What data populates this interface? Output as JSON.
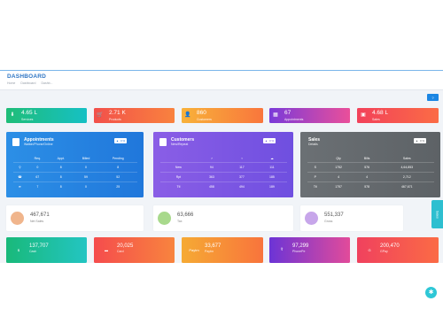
{
  "header": {
    "title": "DASHBOARD",
    "breadcrumb": [
      "Home",
      "Dashboard",
      "Dashb..."
    ],
    "help_label": "?"
  },
  "stats": [
    {
      "value": "4.65 L",
      "label": "Services",
      "icon": "download-icon",
      "gradient": [
        "#1fbd78",
        "#16c0c4"
      ]
    },
    {
      "value": "2.71 K",
      "label": "Products",
      "icon": "cart-icon",
      "gradient": [
        "#f2504b",
        "#f9823e"
      ]
    },
    {
      "value": "860",
      "label": "Customers",
      "icon": "user-icon",
      "gradient": [
        "#f8b23a",
        "#f9763c"
      ]
    },
    {
      "value": "67",
      "label": "Appointments",
      "icon": "calendar-icon",
      "gradient": [
        "#7a3ad9",
        "#ea4f9a"
      ]
    },
    {
      "value": "4.68 L",
      "label": "Sales",
      "icon": "wallet-icon",
      "gradient": [
        "#f2415a",
        "#fb6c45"
      ]
    }
  ],
  "appointments": {
    "title": "Appointments",
    "subtitle": "Walkin/Phone/Online",
    "badge": "0 %",
    "columns": [
      "Req.",
      "Appt.",
      "Billed",
      "Pending"
    ],
    "rows": [
      {
        "icon": "walkin-icon",
        "cells": [
          "0",
          "8",
          "0",
          "8"
        ]
      },
      {
        "icon": "phone-icon",
        "cells": [
          "67",
          "8",
          "59",
          "52"
        ]
      },
      {
        "icon": "wifi-icon",
        "cells": [
          "7",
          "8",
          "0",
          "25"
        ]
      }
    ]
  },
  "customers": {
    "title": "Customers",
    "subtitle": "New/Repeat",
    "badge": "0 %",
    "columns": [
      "",
      "♂",
      "♀",
      "☁"
    ],
    "rows": [
      {
        "icon": "",
        "cells": [
          "New",
          "94",
          "117",
          "111"
        ]
      },
      {
        "icon": "",
        "cells": [
          "Rpt",
          "363",
          "377",
          "185"
        ]
      },
      {
        "icon": "",
        "cells": [
          "Ttl",
          "458",
          "494",
          "189"
        ]
      }
    ]
  },
  "sales": {
    "title": "Sales",
    "subtitle": "Details",
    "badge": "0 %",
    "columns": [
      "",
      "Qty",
      "Bills",
      "Sales"
    ],
    "rows": [
      {
        "icon": "",
        "cells": [
          "S",
          "1752",
          "576",
          "4,64,853"
        ]
      },
      {
        "icon": "",
        "cells": [
          "P",
          "4",
          "4",
          "2,712"
        ]
      },
      {
        "icon": "",
        "cells": [
          "Ttl",
          "1757",
          "578",
          "467,671"
        ]
      }
    ]
  },
  "kpis": [
    {
      "value": "467,671",
      "label": "Net Sales",
      "icon": "wallet-icon",
      "color": "#f0b58c"
    },
    {
      "value": "63,666",
      "label": "Tax",
      "icon": "tax-icon",
      "color": "#a8d98c"
    },
    {
      "value": "551,337",
      "label": "Gross",
      "icon": "coins-icon",
      "color": "#c7a6ea"
    }
  ],
  "payments": [
    {
      "value": "137,707",
      "label": "Cash",
      "logo": "$",
      "gradient": [
        "#19b97a",
        "#23c5c2"
      ]
    },
    {
      "value": "20,025",
      "label": "Card",
      "logo": "▬",
      "gradient": [
        "#f54c4d",
        "#f8843e"
      ]
    },
    {
      "value": "33,677",
      "label": "Paytm",
      "logo": "Paytm",
      "gradient": [
        "#f6aa34",
        "#f8743c"
      ]
    },
    {
      "value": "97,299",
      "label": "PhonePe",
      "logo": "पे",
      "gradient": [
        "#6c34d6",
        "#e24b9a"
      ]
    },
    {
      "value": "200,470",
      "label": "GPay",
      "logo": "G",
      "gradient": [
        "#f0415e",
        "#fb6b45"
      ]
    }
  ],
  "side_tab": "Sales"
}
